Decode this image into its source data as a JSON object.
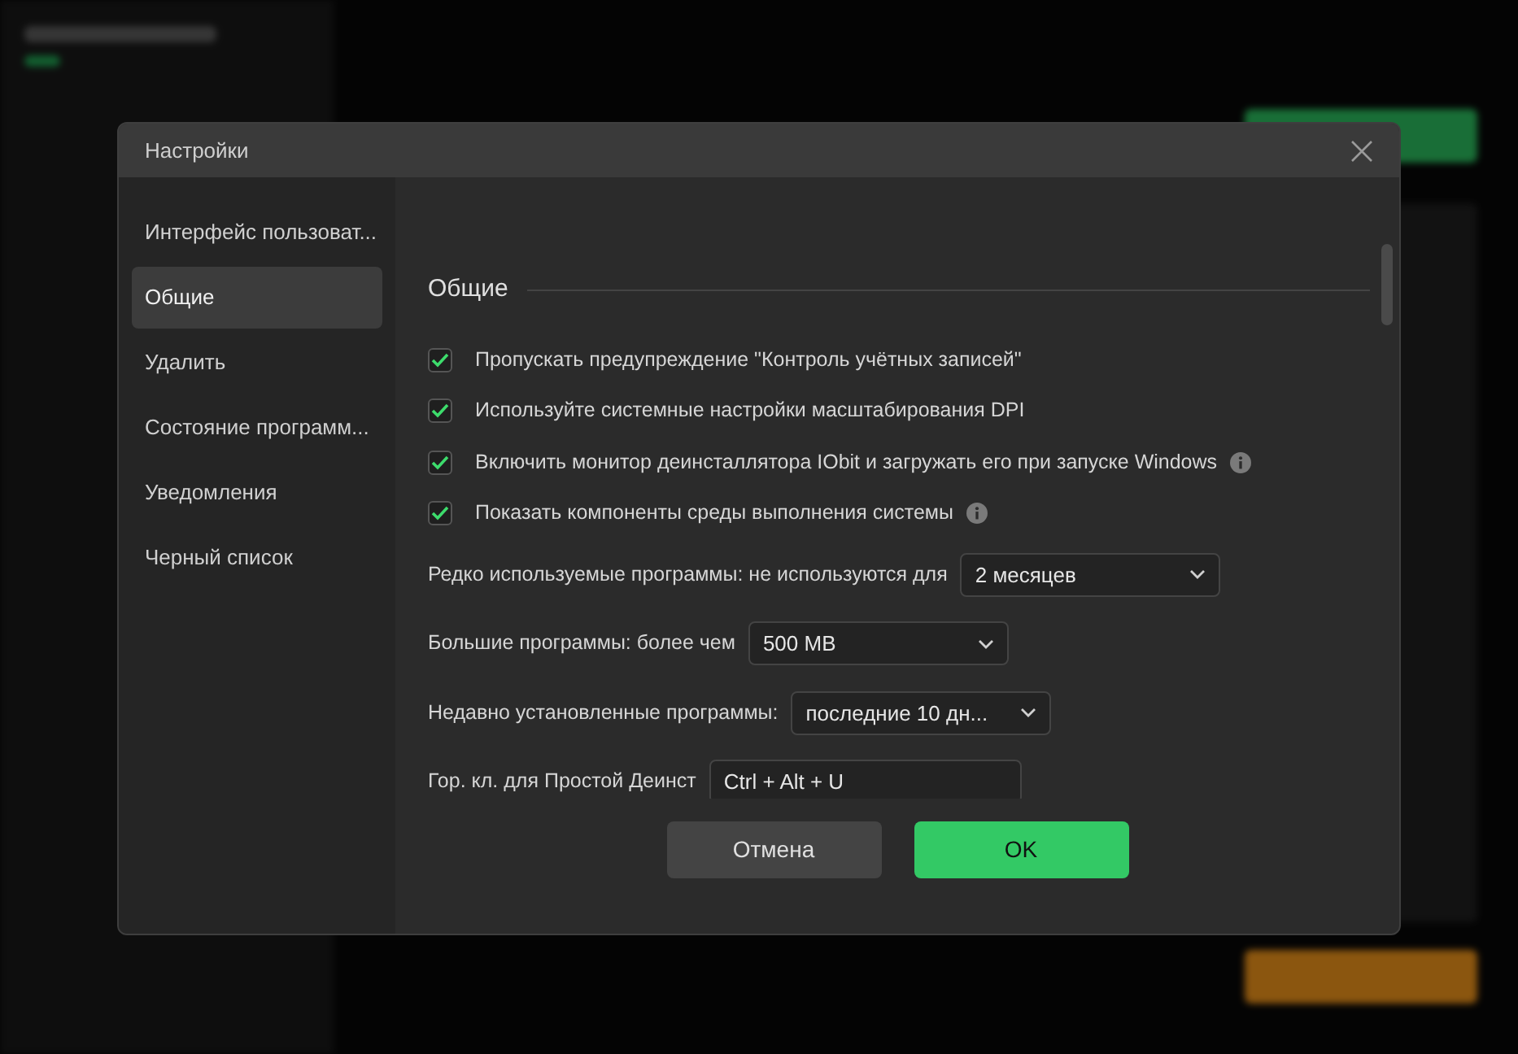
{
  "dialog": {
    "title": "Настройки",
    "nav": [
      {
        "label": "Интерфейс пользоват...",
        "selected": false
      },
      {
        "label": "Общие",
        "selected": true
      },
      {
        "label": "Удалить",
        "selected": false
      },
      {
        "label": "Состояние программ...",
        "selected": false
      },
      {
        "label": "Уведомления",
        "selected": false
      },
      {
        "label": "Черный список",
        "selected": false
      }
    ],
    "section_title": "Общие",
    "options": [
      {
        "kind": "checkbox",
        "label": "Пропускать предупреждение \"Контроль учётных записей\"",
        "checked": true,
        "info": false
      },
      {
        "kind": "checkbox",
        "label": "Используйте системные настройки масштабирования DPI",
        "checked": true,
        "info": false
      },
      {
        "kind": "checkbox",
        "label": "Включить монитор деинсталлятора IObit и загружать его при запуске Windows",
        "checked": true,
        "info": true
      },
      {
        "kind": "checkbox",
        "label": "Показать компоненты среды выполнения системы",
        "checked": true,
        "info": true
      },
      {
        "kind": "dropdown",
        "label": "Редко используемые программы: не используются для",
        "value": "2 месяцев"
      },
      {
        "kind": "dropdown",
        "label": "Большие программы: более чем",
        "value": "500 MB"
      },
      {
        "kind": "dropdown",
        "label": "Недавно установленные программы:",
        "value": "последние 10 дн..."
      },
      {
        "kind": "hotkey",
        "label": "Гор. кл. для Простой Деинст",
        "value": "Ctrl + Alt + U"
      }
    ],
    "buttons": [
      {
        "label": "Отмена",
        "kind": "secondary"
      },
      {
        "label": "OK",
        "kind": "primary"
      }
    ]
  }
}
